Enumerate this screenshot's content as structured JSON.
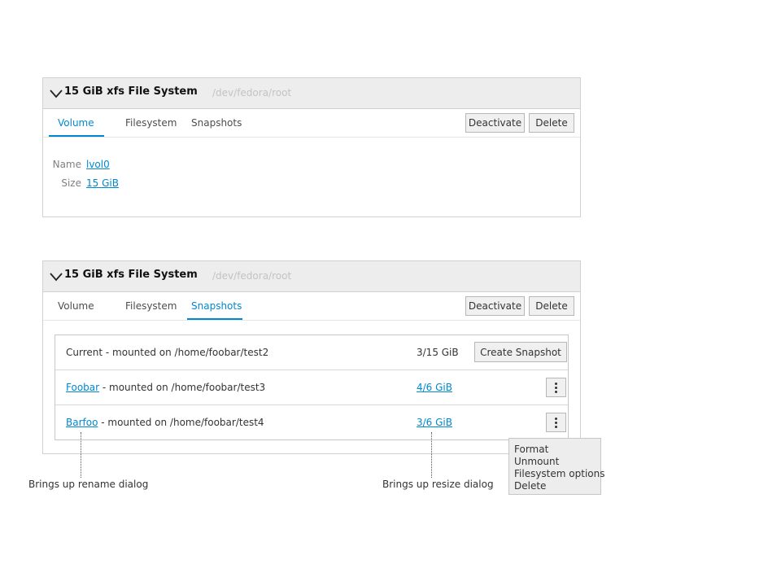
{
  "panel1": {
    "title": "15 GiB xfs File System",
    "device": "/dev/fedora/root",
    "tabs": [
      {
        "label": "Volume",
        "active": true
      },
      {
        "label": "Filesystem",
        "active": false
      },
      {
        "label": "Snapshots",
        "active": false
      }
    ],
    "buttons": {
      "deactivate": "Deactivate",
      "delete": "Delete"
    },
    "properties": [
      {
        "label": "Name",
        "value": "lvol0"
      },
      {
        "label": "Size",
        "value": "15 GiB"
      }
    ]
  },
  "panel2": {
    "title": "15 GiB xfs File System",
    "device": "/dev/fedora/root",
    "tabs": [
      {
        "label": "Volume",
        "active": false
      },
      {
        "label": "Filesystem",
        "active": false
      },
      {
        "label": "Snapshots",
        "active": true
      }
    ],
    "buttons": {
      "deactivate": "Deactivate",
      "delete": "Delete"
    },
    "snapshots": [
      {
        "name": "Current",
        "mount": " - mounted on /home/foobar/test2",
        "size": "3/15 GiB",
        "action": "Create Snapshot"
      },
      {
        "name": "Foobar",
        "mount": " - mounted on /home/foobar/test3",
        "size": "4/6 GiB"
      },
      {
        "name": "Barfoo",
        "mount": " - mounted on /home/foobar/test4",
        "size": "3/6 GiB"
      }
    ]
  },
  "context_menu": {
    "items": [
      "Format",
      "Unmount",
      "Filesystem options",
      "Delete"
    ]
  },
  "annotations": {
    "rename": "Brings up rename dialog",
    "resize": "Brings up resize dialog"
  },
  "icons": {
    "chevron": "chevron-down-icon",
    "kebab": "kebab-menu-icon"
  },
  "colors": {
    "accent": "#0088ce",
    "header_bg": "#ededed",
    "muted_text": "#c3c3c3"
  }
}
